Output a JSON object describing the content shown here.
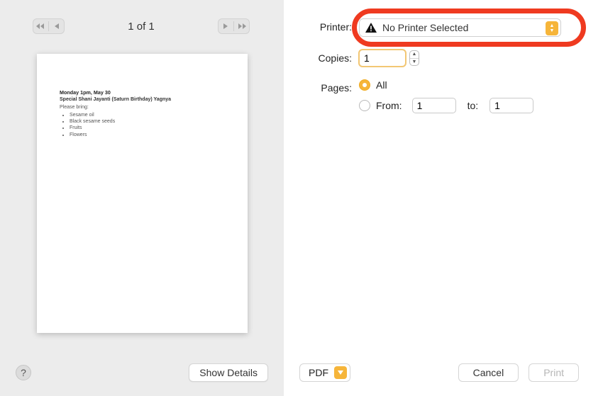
{
  "nav": {
    "page_counter": "1 of 1"
  },
  "preview": {
    "line1": "Monday 1pm, May 30",
    "line2": "Special Shani Jayanti (Saturn Birthday) Yagnya",
    "bring_label": "Please bring:",
    "items": [
      "Sesame oil",
      "Black sesame seeds",
      "Fruits",
      "Flowers"
    ]
  },
  "left_footer": {
    "help_label": "?",
    "show_details_label": "Show Details"
  },
  "form": {
    "printer_label": "Printer:",
    "printer_value": "No Printer Selected",
    "copies_label": "Copies:",
    "copies_value": "1",
    "pages_label": "Pages:",
    "pages_all_label": "All",
    "pages_from_label": "From:",
    "pages_from_value": "1",
    "pages_to_label": "to:",
    "pages_to_value": "1"
  },
  "footer": {
    "pdf_label": "PDF",
    "cancel_label": "Cancel",
    "print_label": "Print"
  }
}
